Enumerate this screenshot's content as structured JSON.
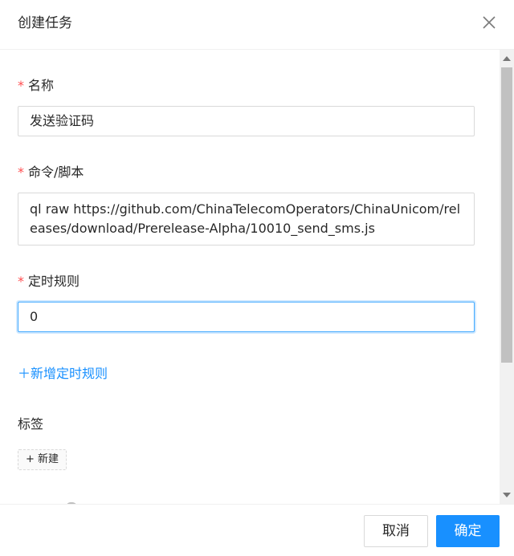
{
  "modal": {
    "title": "创建任务",
    "close_icon": "close-icon"
  },
  "form": {
    "name": {
      "label": "名称",
      "required_mark": "*",
      "value": "发送验证码"
    },
    "command": {
      "label": "命令/脚本",
      "required_mark": "*",
      "value": "ql raw https://github.com/ChinaTelecomOperators/ChinaUnicom/releases/download/Prerelease-Alpha/10010_send_sms.js"
    },
    "schedule": {
      "label": "定时规则",
      "required_mark": "*",
      "value": "0"
    },
    "add_schedule": "＋新增定时规则",
    "tags": {
      "label": "标签",
      "new_button": "+ 新建"
    }
  },
  "footer": {
    "cancel": "取消",
    "ok": "确定"
  },
  "colors": {
    "primary": "#1890ff",
    "required": "#ff4d4f",
    "border": "#d9d9d9"
  }
}
